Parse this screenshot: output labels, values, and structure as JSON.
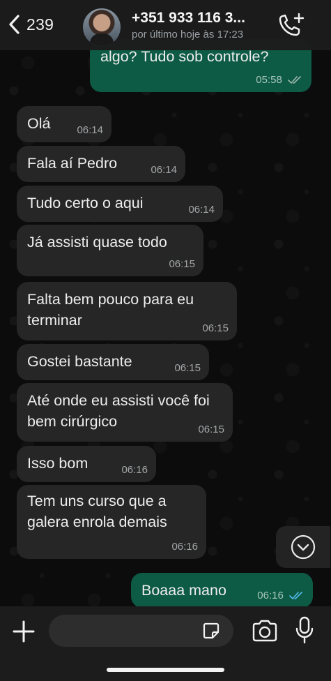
{
  "header": {
    "back_count": "239",
    "contact_name": "+351 933 116 3...",
    "contact_status": "por último hoje às 17:23"
  },
  "messages": [
    {
      "dir": "out",
      "text": "algo? Tudo sob controle?",
      "time": "05:58",
      "ticks": "read-gray"
    },
    {
      "dir": "in",
      "text": "Olá",
      "time": "06:14"
    },
    {
      "dir": "in",
      "text": "Fala aí Pedro",
      "time": "06:14"
    },
    {
      "dir": "in",
      "text": "Tudo certo o aqui",
      "time": "06:14"
    },
    {
      "dir": "in",
      "text": "Já assisti quase todo",
      "time": "06:15"
    },
    {
      "dir": "in",
      "text": "Falta bem pouco para eu terminar",
      "time": "06:15"
    },
    {
      "dir": "in",
      "text": "Gostei bastante",
      "time": "06:15"
    },
    {
      "dir": "in",
      "text": "Até onde eu assisti você foi bem cirúrgico",
      "time": "06:15"
    },
    {
      "dir": "in",
      "text": "Isso bom",
      "time": "06:16"
    },
    {
      "dir": "in",
      "text": "Tem uns curso que a galera enrola demais",
      "time": "06:16"
    },
    {
      "dir": "out",
      "text": "Boaaa mano",
      "time": "06:16",
      "ticks": "read-blue"
    }
  ],
  "composer": {
    "placeholder": ""
  },
  "colors": {
    "incoming_bubble": "#262626",
    "outgoing_bubble": "#0d5a45",
    "read_ticks": "#53bdeb"
  },
  "icons": [
    "back-chevron-icon",
    "add-call-icon",
    "scroll-down-icon",
    "plus-icon",
    "sticker-icon",
    "camera-icon",
    "microphone-icon"
  ]
}
